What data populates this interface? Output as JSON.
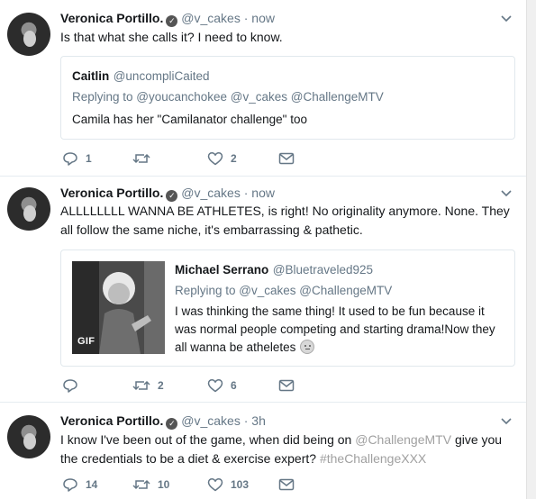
{
  "tweets": [
    {
      "name": "Veronica Portillo.",
      "handle": "@v_cakes",
      "dot": "·",
      "time": "now",
      "text": "Is that what she calls it? I need to know.",
      "quote": {
        "name": "Caitlin",
        "handle": "@uncompliCaited",
        "replying": "Replying to @youcanchokee @v_cakes @ChallengeMTV",
        "text": "Camila has her \"Camilanator challenge\" too"
      },
      "replies": "1",
      "retweets": "",
      "likes": "2"
    },
    {
      "name": "Veronica Portillo.",
      "handle": "@v_cakes",
      "dot": "·",
      "time": "now",
      "text": "ALLLLLLLL WANNA BE ATHLETES, is right!  No originality anymore. None. They all follow the same niche, it's embarrassing & pathetic.",
      "quote": {
        "name": "Michael Serrano",
        "handle": "@Bluetraveled925",
        "replying": "Replying to @v_cakes @ChallengeMTV",
        "text": "I was thinking the same thing! It used to be fun because it was normal people competing and starting drama!Now they all wanna be atheletes",
        "media_label": "GIF"
      },
      "replies": "",
      "retweets": "2",
      "likes": "6"
    },
    {
      "name": "Veronica Portillo.",
      "handle": "@v_cakes",
      "dot": "·",
      "time": "3h",
      "text_before": "I know I've been out of the game, when did being on",
      "mention": "@ChallengeMTV",
      "text_middle": "give you the credentials to be a diet & exercise expert?",
      "hashtag": "#theChallengeXXX",
      "replies": "14",
      "retweets": "10",
      "likes": "103"
    }
  ],
  "icons": {
    "verified": "verified-badge-icon",
    "caret": "chevron-down-icon",
    "reply": "reply-icon",
    "retweet": "retweet-icon",
    "like": "heart-icon",
    "dm": "envelope-icon"
  },
  "colors": {
    "text": "#14171a",
    "secondary": "#657786",
    "link": "#a0a0a0",
    "border": "#e6ecf0"
  }
}
